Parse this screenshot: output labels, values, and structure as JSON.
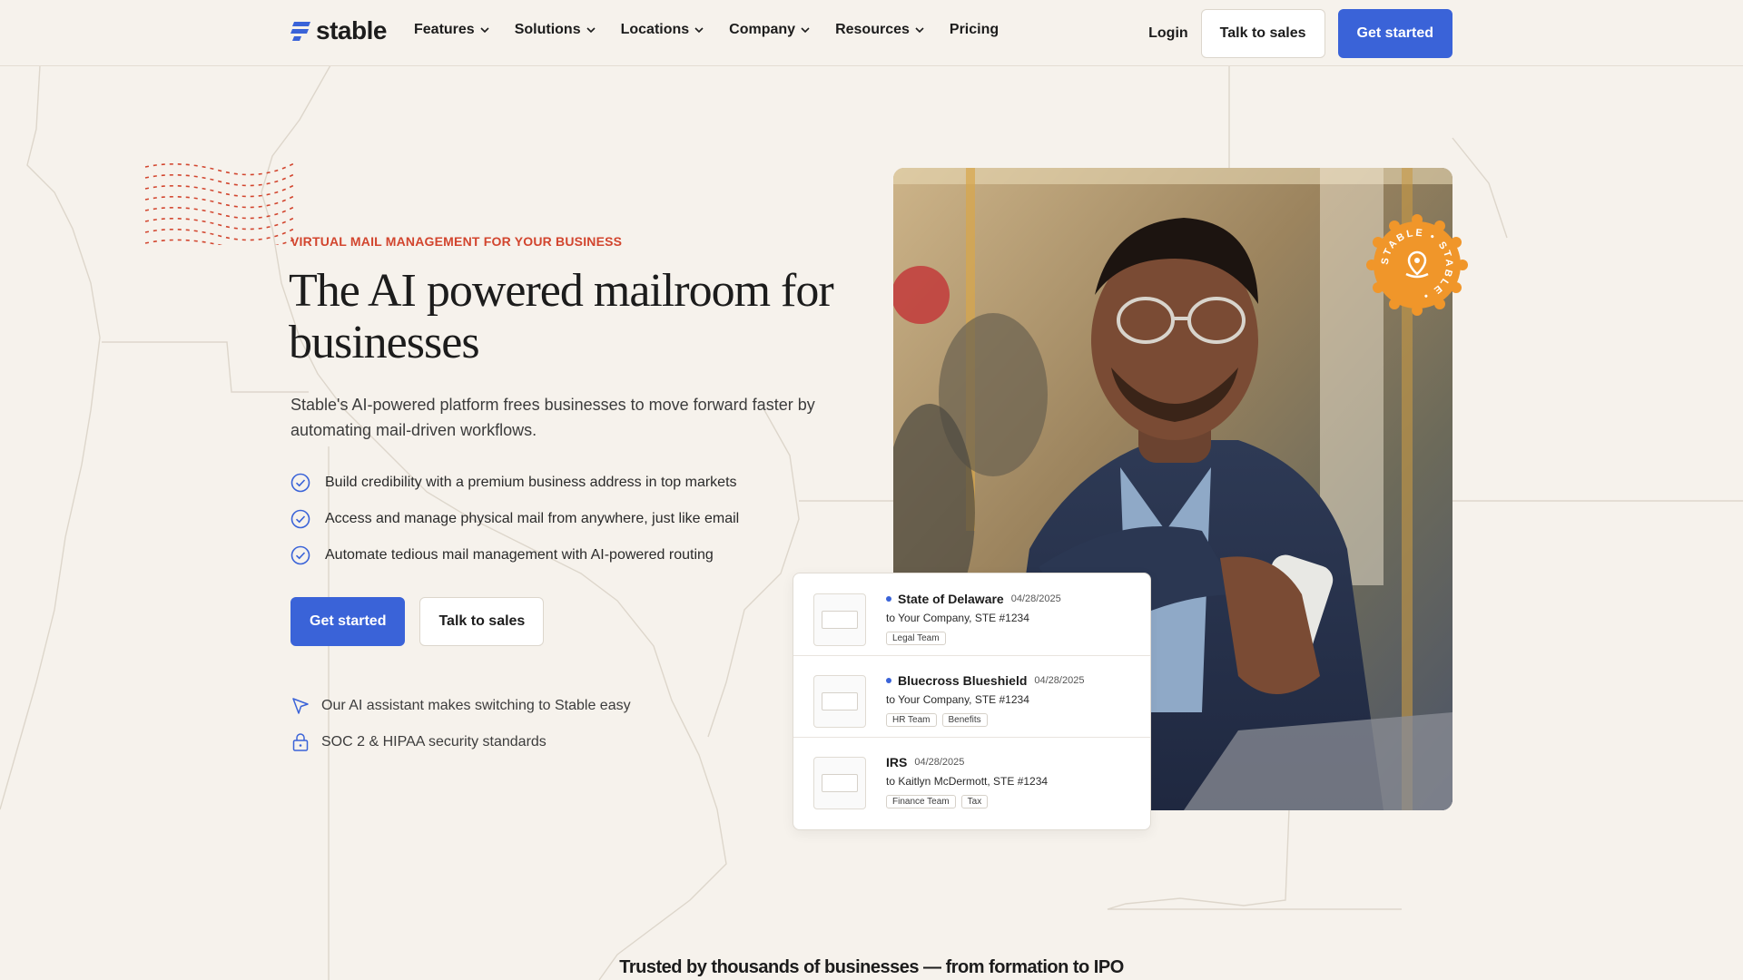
{
  "nav": {
    "logo_text": "stable",
    "menu": [
      {
        "label": "Features",
        "has_dropdown": true
      },
      {
        "label": "Solutions",
        "has_dropdown": true
      },
      {
        "label": "Locations",
        "has_dropdown": true
      },
      {
        "label": "Company",
        "has_dropdown": true
      },
      {
        "label": "Resources",
        "has_dropdown": true
      },
      {
        "label": "Pricing",
        "has_dropdown": false
      }
    ],
    "login": "Login",
    "talk_to_sales": "Talk to sales",
    "get_started": "Get started"
  },
  "hero": {
    "eyebrow": "VIRTUAL MAIL MANAGEMENT FOR YOUR BUSINESS",
    "headline": "The AI powered mailroom for businesses",
    "subtext": "Stable's AI-powered platform frees businesses to move forward faster by automating mail-driven workflows.",
    "bullets": [
      "Build credibility with a premium business address in top markets",
      "Access and manage physical mail from anywhere, just like email",
      "Automate tedious mail management with AI-powered routing"
    ],
    "cta_primary": "Get started",
    "cta_secondary": "Talk to sales",
    "assurances": [
      {
        "icon": "cursor-arrow-icon",
        "text": "Our AI assistant makes switching to Stable easy"
      },
      {
        "icon": "lock-icon",
        "text": "SOC 2 & HIPAA security standards"
      }
    ]
  },
  "badge": {
    "text": "STABLE • STABLE •",
    "icon": "map-pin-icon"
  },
  "mail_items": [
    {
      "title": "State of Delaware",
      "date": "04/28/2025",
      "to": "to Your Company, STE #1234",
      "tags": [
        "Legal Team"
      ],
      "unread": true
    },
    {
      "title": "Bluecross Blueshield",
      "date": "04/28/2025",
      "to": "to Your Company, STE #1234",
      "tags": [
        "HR Team",
        "Benefits"
      ],
      "unread": true
    },
    {
      "title": "IRS",
      "date": "04/28/2025",
      "to": "to Kaitlyn McDermott, STE #1234",
      "tags": [
        "Finance Team",
        "Tax"
      ],
      "unread": false
    }
  ],
  "trusted": "Trusted by thousands of businesses — from formation to IPO",
  "colors": {
    "background": "#f6f2ec",
    "primary": "#3a63d8",
    "accent": "#d2452e",
    "badge": "#f0962a",
    "text": "#1c1c1c"
  }
}
